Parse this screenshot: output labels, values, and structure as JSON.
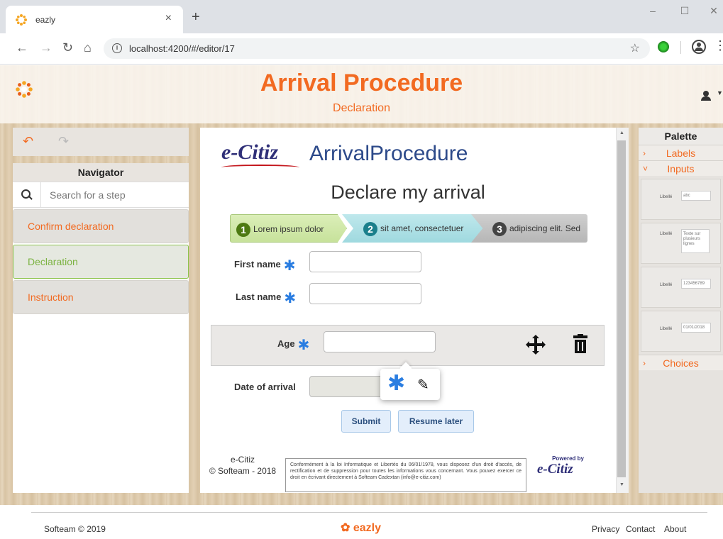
{
  "browser": {
    "tab_title": "eazly",
    "tab_close": "×",
    "new_tab": "+",
    "url": "localhost:4200/#/editor/17",
    "window_controls": [
      "–",
      "☐",
      "✕"
    ]
  },
  "header": {
    "title": "Arrival Procedure",
    "subtitle": "Declaration"
  },
  "navigator": {
    "title": "Navigator",
    "search_placeholder": "Search for a step",
    "items": [
      {
        "label": "Confirm declaration",
        "active": false
      },
      {
        "label": "Declaration",
        "active": true
      },
      {
        "label": "Instruction",
        "active": false
      }
    ]
  },
  "editor": {
    "logo_text": "e-Citiz",
    "procedure_title": "ArrivalProcedure",
    "form_title": "Declare my arrival",
    "steps": [
      {
        "num": "1",
        "label": "Lorem ipsum dolor"
      },
      {
        "num": "2",
        "label": "sit amet, consectetuer"
      },
      {
        "num": "3",
        "label": "adipiscing elit. Sed"
      }
    ],
    "fields": {
      "first_name": "First name",
      "last_name": "Last name",
      "age": "Age",
      "date_of_arrival": "Date of arrival"
    },
    "required_mark": "✱",
    "buttons": {
      "submit": "Submit",
      "resume": "Resume later"
    },
    "footer": {
      "brand": "e-Citiz",
      "copyright": "© Softeam - 2018",
      "legal": "Conformément à la loi Informatique et Libertés du 06/01/1978, vous disposez d'un droit d'accès, de rectification et de suppression pour toutes les informations vous concernant. Vous pouvez exercer ce droit en écrivant directement à Softeam Cadextan (info@e-citiz.com)",
      "powered_by": "Powered by",
      "powered_logo": "e-Citiz"
    }
  },
  "palette": {
    "title": "Palette",
    "sections": {
      "labels": "Labels",
      "inputs": "Inputs",
      "choices": "Choices"
    },
    "cards": [
      {
        "label": "Libellé",
        "sample": "abc"
      },
      {
        "label": "Libellé",
        "sample": "Texte sur plusieurs lignes"
      },
      {
        "label": "Libellé",
        "sample": "123456789"
      },
      {
        "label": "Libellé",
        "sample": "01/01/2018"
      }
    ]
  },
  "footer": {
    "copyright": "Softeam © 2019",
    "logo": "eazly",
    "links": [
      "Privacy",
      "Contact",
      "About"
    ]
  },
  "colors": {
    "accent": "#f26a21",
    "active_green": "#7cb342",
    "required_blue": "#2a7de1"
  }
}
